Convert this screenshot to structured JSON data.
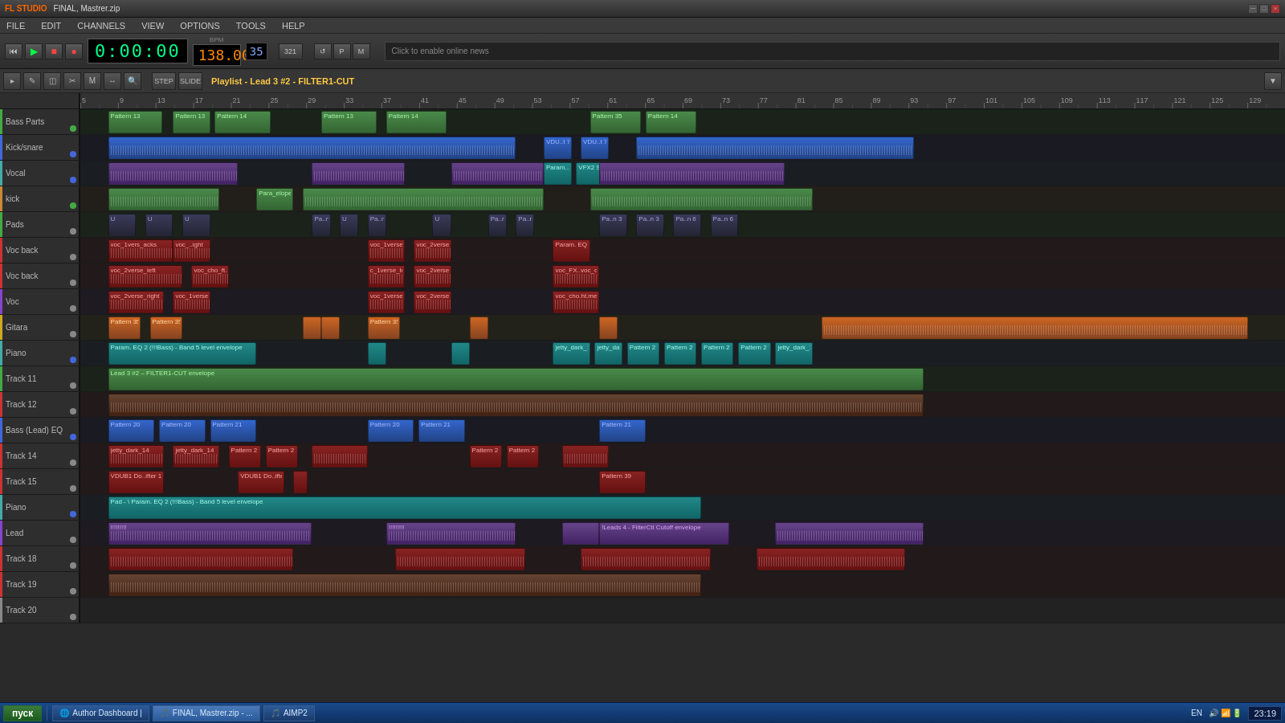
{
  "titlebar": {
    "logo": "FL STUDIO",
    "title": "FINAL, Mastrer.zip",
    "win_buttons": [
      "-",
      "□",
      "×"
    ]
  },
  "menubar": {
    "items": [
      "FILE",
      "EDIT",
      "CHANNELS",
      "VIEW",
      "OPTIONS",
      "TOOLS",
      "HELP"
    ]
  },
  "transport": {
    "time": "0:00:00",
    "bpm": "138.000",
    "tempo": "35",
    "play_label": "▶",
    "stop_label": "■",
    "rec_label": "●",
    "pattern_num": "321"
  },
  "toolbar": {
    "playlist_title": "Playlist - Lead 3 #2 - FILTER1-CUT"
  },
  "ruler": {
    "marks": [
      "5",
      "9",
      "13",
      "17",
      "21",
      "25",
      "29",
      "33",
      "37",
      "41",
      "45",
      "49",
      "53",
      "57",
      "61",
      "65",
      "69",
      "73",
      "77",
      "81",
      "85",
      "89",
      "93",
      "97",
      "101",
      "105",
      "109",
      "113",
      "117",
      "121",
      "125",
      "129"
    ]
  },
  "tracks": [
    {
      "label": "Bass Parts",
      "color": "green",
      "dot": "green"
    },
    {
      "label": "Kick/snare",
      "color": "blue",
      "dot": "blue"
    },
    {
      "label": "Vocal",
      "color": "teal",
      "dot": "blue"
    },
    {
      "label": "kick",
      "color": "orange",
      "dot": "green"
    },
    {
      "label": "Pads",
      "color": "green",
      "dot": "gray"
    },
    {
      "label": "Voc back",
      "color": "red",
      "dot": "gray"
    },
    {
      "label": "Voc back",
      "color": "red",
      "dot": "gray"
    },
    {
      "label": "Voc",
      "color": "purple",
      "dot": "gray"
    },
    {
      "label": "Gitara",
      "color": "yellow",
      "dot": "gray"
    },
    {
      "label": "Piano",
      "color": "teal",
      "dot": "blue"
    },
    {
      "label": "Track 11",
      "color": "green",
      "dot": "gray"
    },
    {
      "label": "Track 12",
      "color": "red",
      "dot": "gray"
    },
    {
      "label": "Bass (Lead) EQ",
      "color": "blue",
      "dot": "blue"
    },
    {
      "label": "Track 14",
      "color": "red",
      "dot": "gray"
    },
    {
      "label": "Track 15",
      "color": "red",
      "dot": "gray"
    },
    {
      "label": "Piano",
      "color": "teal",
      "dot": "blue"
    },
    {
      "label": "Lead",
      "color": "purple",
      "dot": "gray"
    },
    {
      "label": "Track 18",
      "color": "red",
      "dot": "gray"
    },
    {
      "label": "Track 19",
      "color": "red",
      "dot": "gray"
    },
    {
      "label": "Track 20",
      "color": "gray",
      "dot": "gray"
    }
  ],
  "taskbar": {
    "start_label": "пуск",
    "items": [
      {
        "label": "Author Dashboard |",
        "icon": "🌐",
        "active": false
      },
      {
        "label": "FINAL, Mastrer.zip - ...",
        "icon": "🎵",
        "active": true
      },
      {
        "label": "AIMP2",
        "icon": "🎵",
        "active": false
      }
    ],
    "systray": {
      "lang": "EN",
      "time": "23:19"
    }
  }
}
